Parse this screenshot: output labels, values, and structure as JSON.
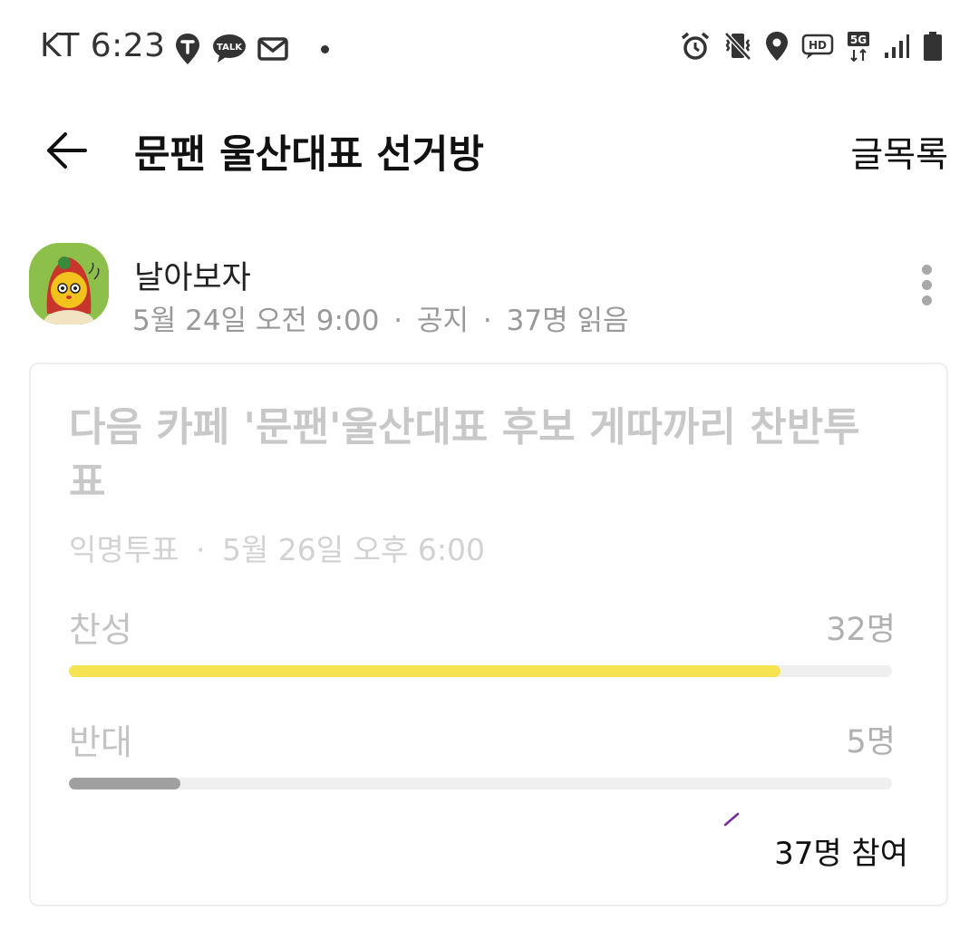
{
  "status_bar": {
    "carrier_time": "KT 6:23",
    "left_icons": [
      "tmap-icon",
      "kakaotalk-icon",
      "mail-icon",
      "notification-dot-icon"
    ],
    "right_icons": [
      "alarm-icon",
      "vibrate-icon",
      "location-icon",
      "hd-voice-icon",
      "5g-icon",
      "signal-icon",
      "battery-icon"
    ],
    "talk_label": "TALK",
    "hd_label": "HD",
    "network_label": "5G"
  },
  "header": {
    "title": "문팬 울산대표 선거방",
    "list_button": "글목록"
  },
  "post": {
    "author": "날아보자",
    "date": "5월 24일 오전 9:00",
    "category": "공지",
    "read_count": "37명 읽음",
    "separator": "·"
  },
  "vote": {
    "title": "다음 카페 '문팬'울산대표 후보 게따까리 찬반투표",
    "type": "익명투표",
    "deadline": "5월 26일 오후 6:00",
    "options": [
      {
        "label": "찬성",
        "count_text": "32명",
        "votes": 32,
        "share": 0.865
      },
      {
        "label": "반대",
        "count_text": "5명",
        "votes": 5,
        "share": 0.135
      }
    ],
    "participants": "37명 참여"
  },
  "colors": {
    "yes_bar": "#f5e34f",
    "no_bar": "#a0a0a0",
    "track": "#efefef",
    "text_primary": "#111111",
    "text_muted": "#999999"
  }
}
